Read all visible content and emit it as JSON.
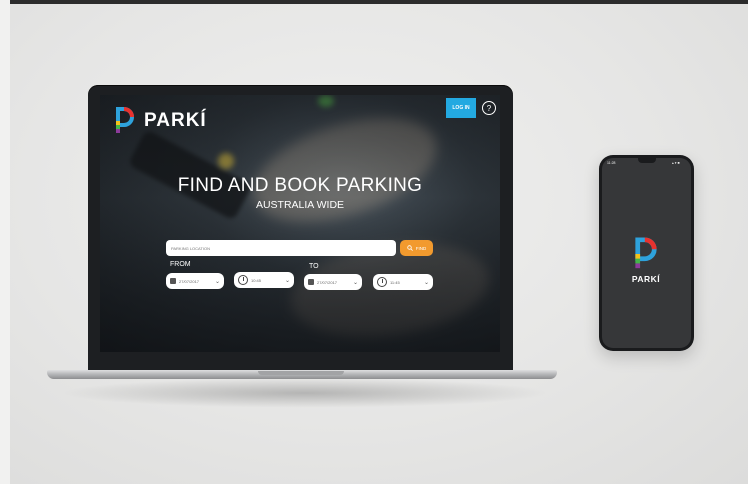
{
  "brand": {
    "name": "PARKÍ"
  },
  "nav": {
    "login_label": "LOG IN",
    "help_label": "?"
  },
  "hero": {
    "title": "FIND AND BOOK PARKING",
    "subtitle": "AUSTRALIA WIDE"
  },
  "search": {
    "placeholder": "PARKING LOCATION",
    "find_label": "FIND"
  },
  "from": {
    "label": "FROM",
    "date": "27/07/2017",
    "time": "10:45"
  },
  "to": {
    "label": "TO",
    "date": "27/07/2017",
    "time": "11:45"
  },
  "phone": {
    "time": "11:28",
    "status": "▴ ▾ ■",
    "brand": "PARKÍ"
  },
  "colors": {
    "accent_blue": "#23a9e1",
    "accent_orange": "#f29a2e",
    "logo_red": "#e8322e",
    "logo_yellow": "#f4c21b",
    "logo_green": "#44b649",
    "logo_blue": "#2ea2dc",
    "logo_purple": "#8c3b9b"
  }
}
